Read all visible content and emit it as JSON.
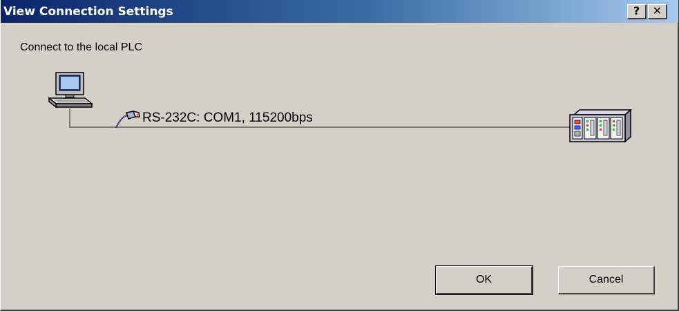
{
  "window": {
    "title": "View Connection Settings",
    "help_label": "?",
    "close_label": "✕"
  },
  "content": {
    "connect_label": "Connect to the local PLC",
    "connection_text": "RS-232C: COM1, 115200bps"
  },
  "icons": {
    "pc": "computer-icon",
    "serial": "serial-cable-icon",
    "plc": "plc-icon"
  },
  "buttons": {
    "ok_label": "OK",
    "cancel_label": "Cancel"
  },
  "colors": {
    "titlebar_start": "#0a246a",
    "titlebar_end": "#a6caf0",
    "face": "#d4d0c8",
    "line": "#7b7b7b"
  }
}
